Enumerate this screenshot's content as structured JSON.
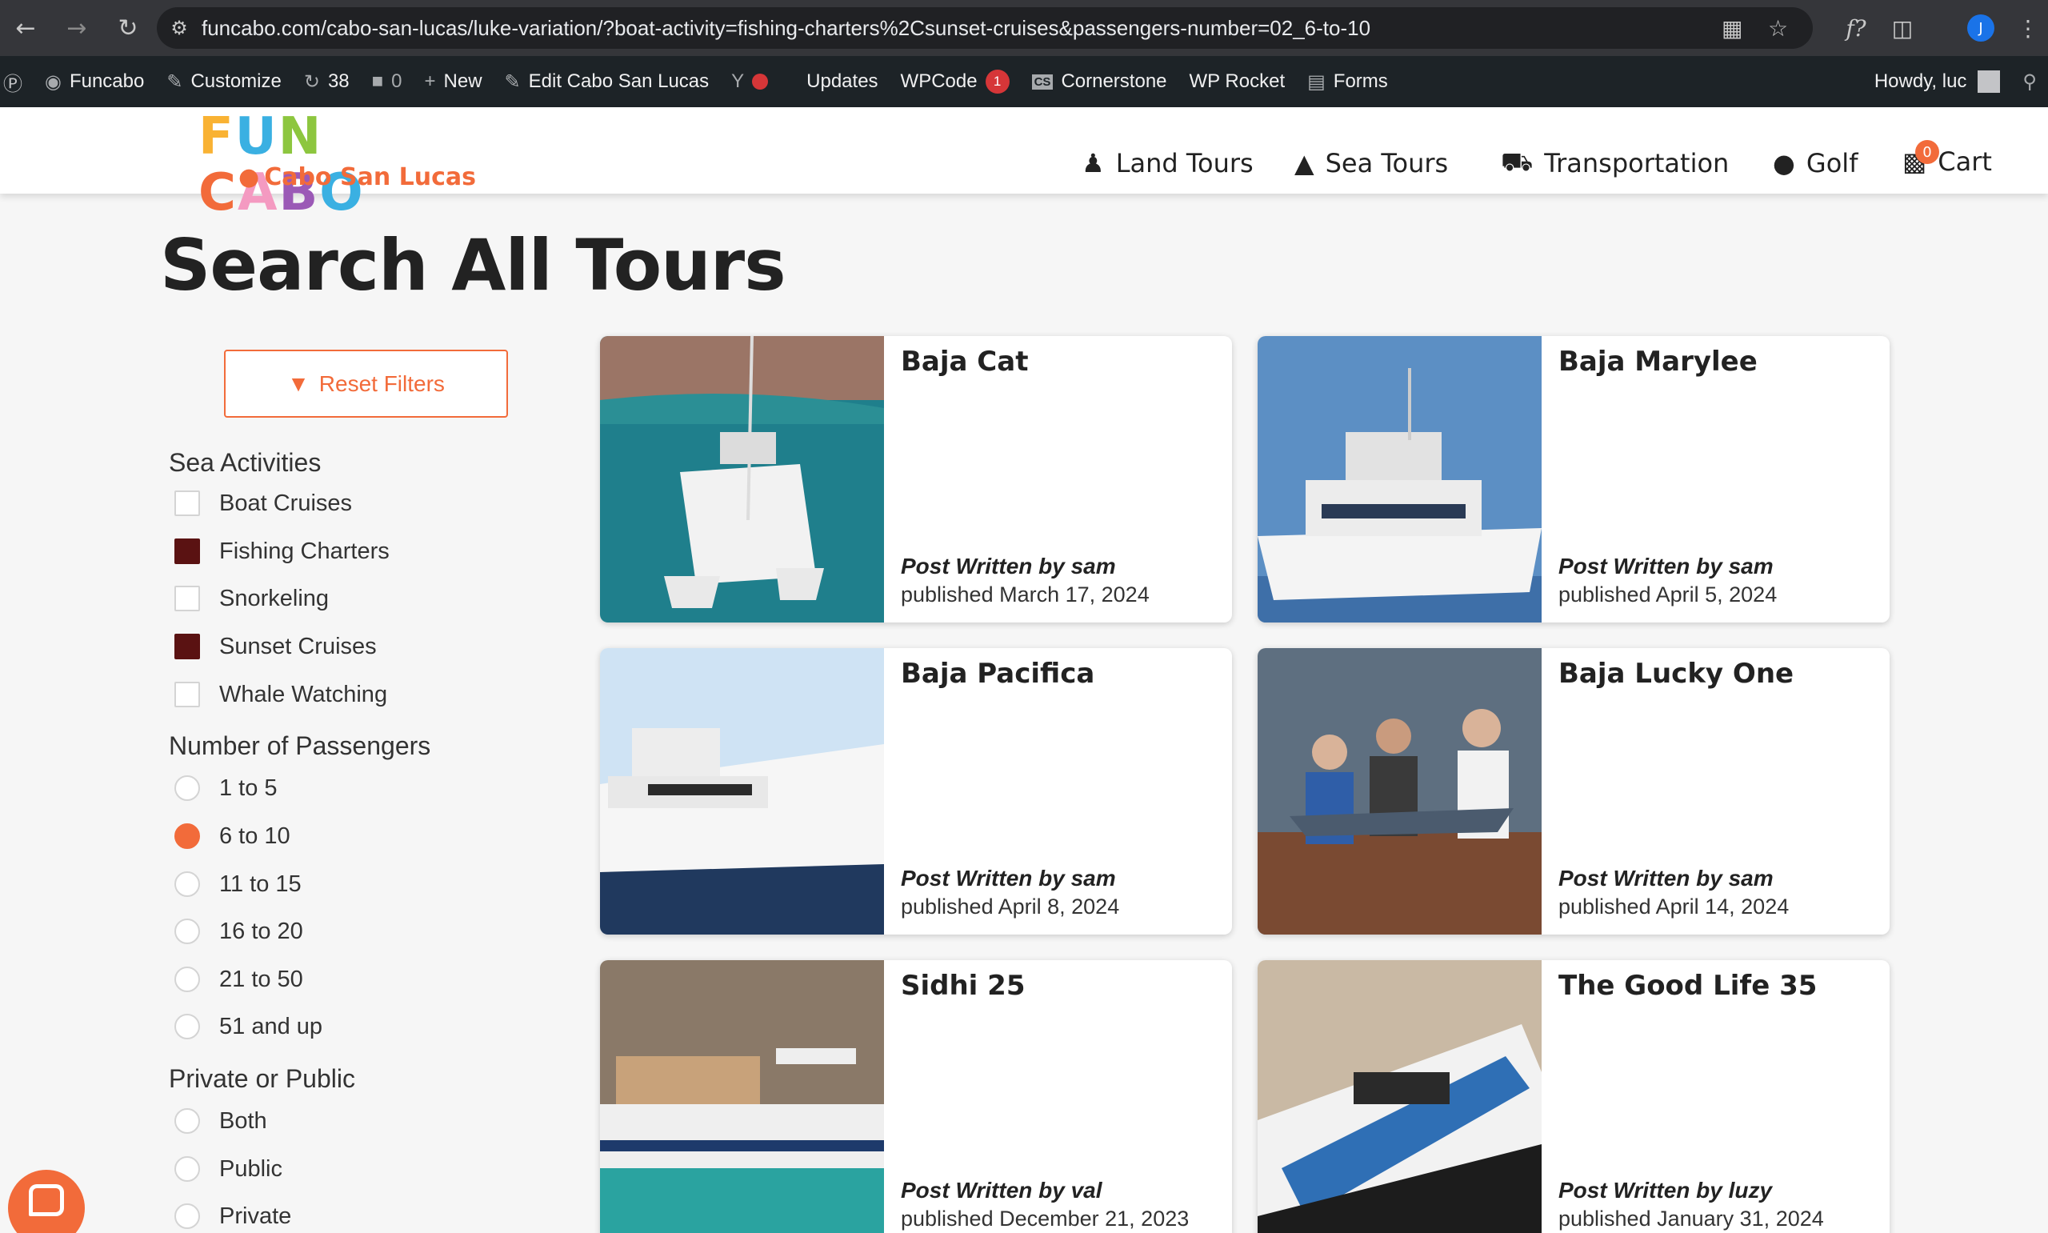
{
  "browser": {
    "url": "funcabo.com/cabo-san-lucas/luke-variation/?boat-activity=fishing-charters%2Csunset-cruises&passengers-number=02_6-to-10",
    "profile_initial": "J"
  },
  "admin_bar": {
    "site_name": "Funcabo",
    "customize": "Customize",
    "updates_count": "38",
    "comments_count": "0",
    "new": "New",
    "edit_page": "Edit Cabo San Lucas",
    "updates": "Updates",
    "wpcode": "WPCode",
    "wpcode_badge": "1",
    "cornerstone": "Cornerstone",
    "cornerstone_icon": "CS",
    "wp_rocket": "WP Rocket",
    "forms": "Forms",
    "howdy": "Howdy, luc"
  },
  "header": {
    "logo_main": [
      "F",
      "U",
      "N",
      " ",
      "C",
      "A",
      "B",
      "O"
    ],
    "logo_sub": "Cabo San Lucas",
    "nav": [
      {
        "label": "Land Tours",
        "icon": "hiker-icon"
      },
      {
        "label": "Sea Tours",
        "icon": "sailboat-icon"
      },
      {
        "label": "Transportation",
        "icon": "van-icon"
      },
      {
        "label": "Golf",
        "icon": "golf-icon"
      }
    ],
    "cart_label": "Cart",
    "cart_count": "0"
  },
  "page": {
    "title": "Search All Tours",
    "reset_label": "Reset Filters"
  },
  "filters": {
    "sea_activities": {
      "heading": "Sea Activities",
      "options": [
        {
          "label": "Boat Cruises",
          "checked": false
        },
        {
          "label": "Fishing Charters",
          "checked": true
        },
        {
          "label": "Snorkeling",
          "checked": false
        },
        {
          "label": "Sunset Cruises",
          "checked": true
        },
        {
          "label": "Whale Watching",
          "checked": false
        }
      ]
    },
    "passengers": {
      "heading": "Number of Passengers",
      "options": [
        {
          "label": "1 to 5",
          "checked": false
        },
        {
          "label": "6 to 10",
          "checked": true
        },
        {
          "label": "11 to 15",
          "checked": false
        },
        {
          "label": "16 to 20",
          "checked": false
        },
        {
          "label": "21 to 50",
          "checked": false
        },
        {
          "label": "51 and up",
          "checked": false
        }
      ]
    },
    "privacy": {
      "heading": "Private or Public",
      "options": [
        {
          "label": "Both",
          "checked": false
        },
        {
          "label": "Public",
          "checked": false
        },
        {
          "label": "Private",
          "checked": false
        }
      ]
    }
  },
  "tours": [
    {
      "title": "Baja Cat",
      "author": "Post Written by sam",
      "date": "published March 17, 2024"
    },
    {
      "title": "Baja Marylee",
      "author": "Post Written by sam",
      "date": "published April 5, 2024"
    },
    {
      "title": "Baja Pacifica",
      "author": "Post Written by sam",
      "date": "published April 8, 2024"
    },
    {
      "title": "Baja Lucky One",
      "author": "Post Written by sam",
      "date": "published April 14, 2024"
    },
    {
      "title": "Sidhi 25",
      "author": "Post Written by val",
      "date": "published December 21, 2023"
    },
    {
      "title": "The Good Life 35",
      "author": "Post Written by luzy",
      "date": "published January 31, 2024"
    }
  ],
  "colors": {
    "accent": "#f26b3a",
    "checked_box": "#5a1212",
    "admin_bar": "#1d2327"
  }
}
